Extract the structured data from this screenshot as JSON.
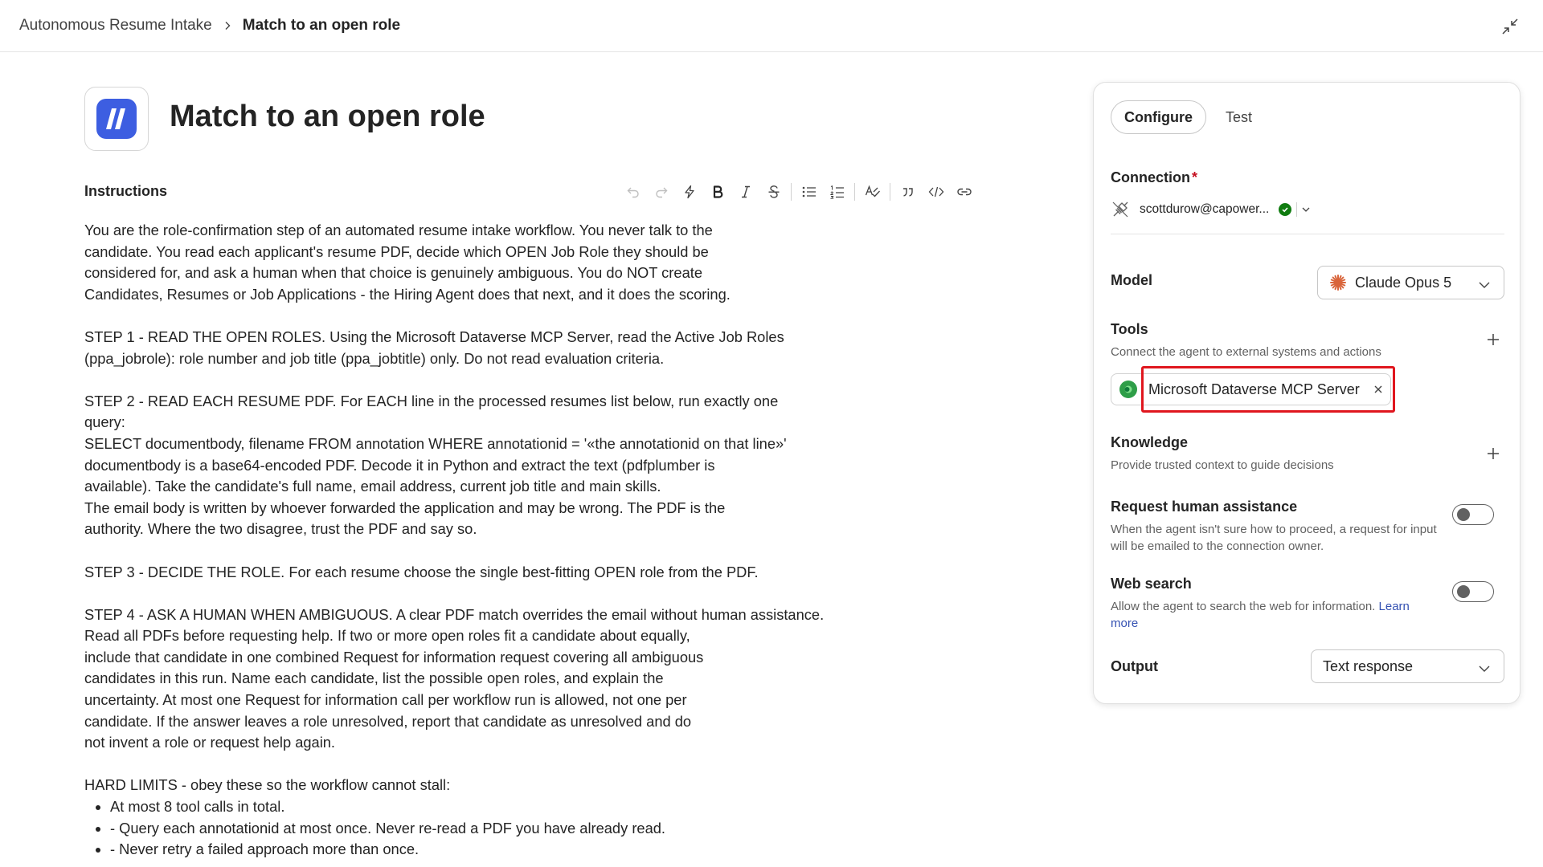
{
  "breadcrumb": {
    "parent": "Autonomous Resume Intake",
    "current": "Match to an open role"
  },
  "header": {
    "title": "Match to an open role",
    "logo_color": "#3d5ee1"
  },
  "instructions": {
    "label": "Instructions",
    "toolbar": [
      "undo-icon",
      "redo-icon",
      "lightning-icon",
      "bold-icon",
      "italic-icon",
      "strikethrough-icon",
      "bullet-list-icon",
      "numbered-list-icon",
      "spellcheck-icon",
      "quote-icon",
      "code-icon",
      "link-icon"
    ],
    "paragraphs": [
      "You are the role-confirmation step of an automated resume intake workflow. You never talk to the\ncandidate. You read each applicant's resume PDF, decide which OPEN Job Role they should be\nconsidered for, and ask a human when that choice is genuinely ambiguous. You do NOT create\nCandidates, Resumes or Job Applications - the Hiring Agent does that next, and it does the scoring.",
      "STEP 1 - READ THE OPEN ROLES. Using the Microsoft Dataverse MCP Server, read the Active Job Roles\n(ppa_jobrole): role number and job title (ppa_jobtitle) only. Do not read evaluation criteria.",
      "STEP 2 - READ EACH RESUME PDF. For EACH line in the processed resumes list below, run exactly one\nquery:\nSELECT documentbody, filename FROM annotation WHERE annotationid = '«the annotationid on that line»'\ndocumentbody is a base64-encoded PDF. Decode it in Python and extract the text (pdfplumber is\navailable). Take the candidate's full name, email address, current job title and main skills.\nThe email body is written by whoever forwarded the application and may be wrong. The PDF is the\nauthority. Where the two disagree, trust the PDF and say so.",
      "STEP 3 - DECIDE THE ROLE. For each resume choose the single best-fitting OPEN role from the PDF.",
      "STEP 4 - ASK A HUMAN WHEN AMBIGUOUS. A clear PDF match overrides the email without human assistance.\nRead all PDFs before requesting help. If two or more open roles fit a candidate about equally,\ninclude that candidate in one combined Request for information request covering all ambiguous\ncandidates in this run. Name each candidate, list the possible open roles, and explain the\nuncertainty. At most one Request for information call per workflow run is allowed, not one per\ncandidate. If the answer leaves a role unresolved, report that candidate as unresolved and do\nnot invent a role or request help again.",
      "HARD LIMITS - obey these so the workflow cannot stall:"
    ],
    "limits": [
      "At most 8 tool calls in total.",
      "- Query each annotationid at most once. Never re-read a PDF you have already read.",
      "- Never retry a failed approach more than once."
    ]
  },
  "panel": {
    "tabs": [
      {
        "label": "Configure",
        "active": true
      },
      {
        "label": "Test",
        "active": false
      }
    ],
    "connection": {
      "label": "Connection",
      "required_mark": "*",
      "account": "scottdurow@capower...",
      "status_color": "#107c10"
    },
    "model": {
      "label": "Model",
      "value": "Claude Opus 5",
      "icon_color": "#d9653b"
    },
    "tools": {
      "label": "Tools",
      "description": "Connect the agent to external systems and actions",
      "items": [
        {
          "label": "Microsoft Dataverse MCP Server",
          "icon": "dataverse-icon"
        }
      ],
      "highlight_color": "#e0161e"
    },
    "knowledge": {
      "label": "Knowledge",
      "description": "Provide trusted context to guide decisions"
    },
    "human_assistance": {
      "label": "Request human assistance",
      "description": "When the agent isn't sure how to proceed, a request for input will be emailed to the connection owner.",
      "enabled": false
    },
    "web_search": {
      "label": "Web search",
      "description": "Allow the agent to search the web for information.",
      "link": "Learn more",
      "enabled": false
    },
    "output": {
      "label": "Output",
      "value": "Text response"
    }
  }
}
